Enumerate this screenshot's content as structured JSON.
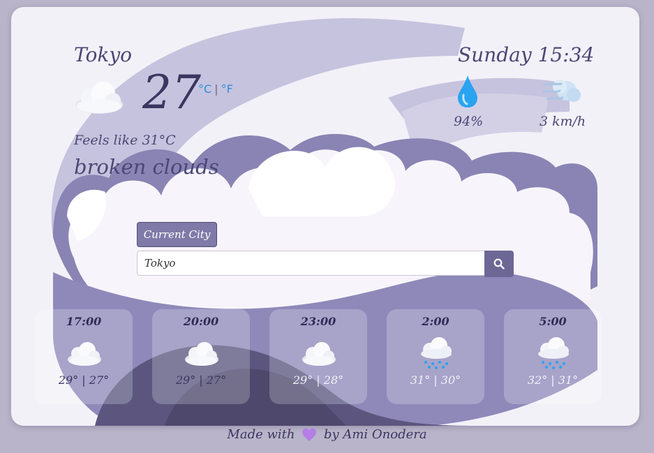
{
  "weather": {
    "city": "Tokyo",
    "temperature": "27",
    "unit_c": "°C",
    "unit_sep": "|",
    "unit_f": "°F",
    "feels_like": "Feels like 31°C",
    "description": "broken clouds",
    "datetime": "Sunday 15:34",
    "humidity": "94%",
    "wind": "3 km/h",
    "icon": "cloud-icon"
  },
  "search": {
    "current_city_label": "Current City",
    "value": "Tokyo",
    "button_icon": "search-icon"
  },
  "forecast": [
    {
      "time": "17:00",
      "range": "29° | 27°",
      "icon": "cloud-icon"
    },
    {
      "time": "20:00",
      "range": "29° | 27°",
      "icon": "cloud-icon"
    },
    {
      "time": "23:00",
      "range": "29° | 28°",
      "icon": "cloud-icon"
    },
    {
      "time": "2:00",
      "range": "31° | 30°",
      "icon": "cloud-rain-icon"
    },
    {
      "time": "5:00",
      "range": "32° | 31°",
      "icon": "cloud-rain-icon"
    }
  ],
  "footer": {
    "prefix": "Made with",
    "suffix": "by Ami Onodera",
    "heart_color": "#b57ee6"
  },
  "colors": {
    "accent": "#807aa8",
    "text": "#4b4775",
    "unit_link": "#2e8fdc"
  }
}
